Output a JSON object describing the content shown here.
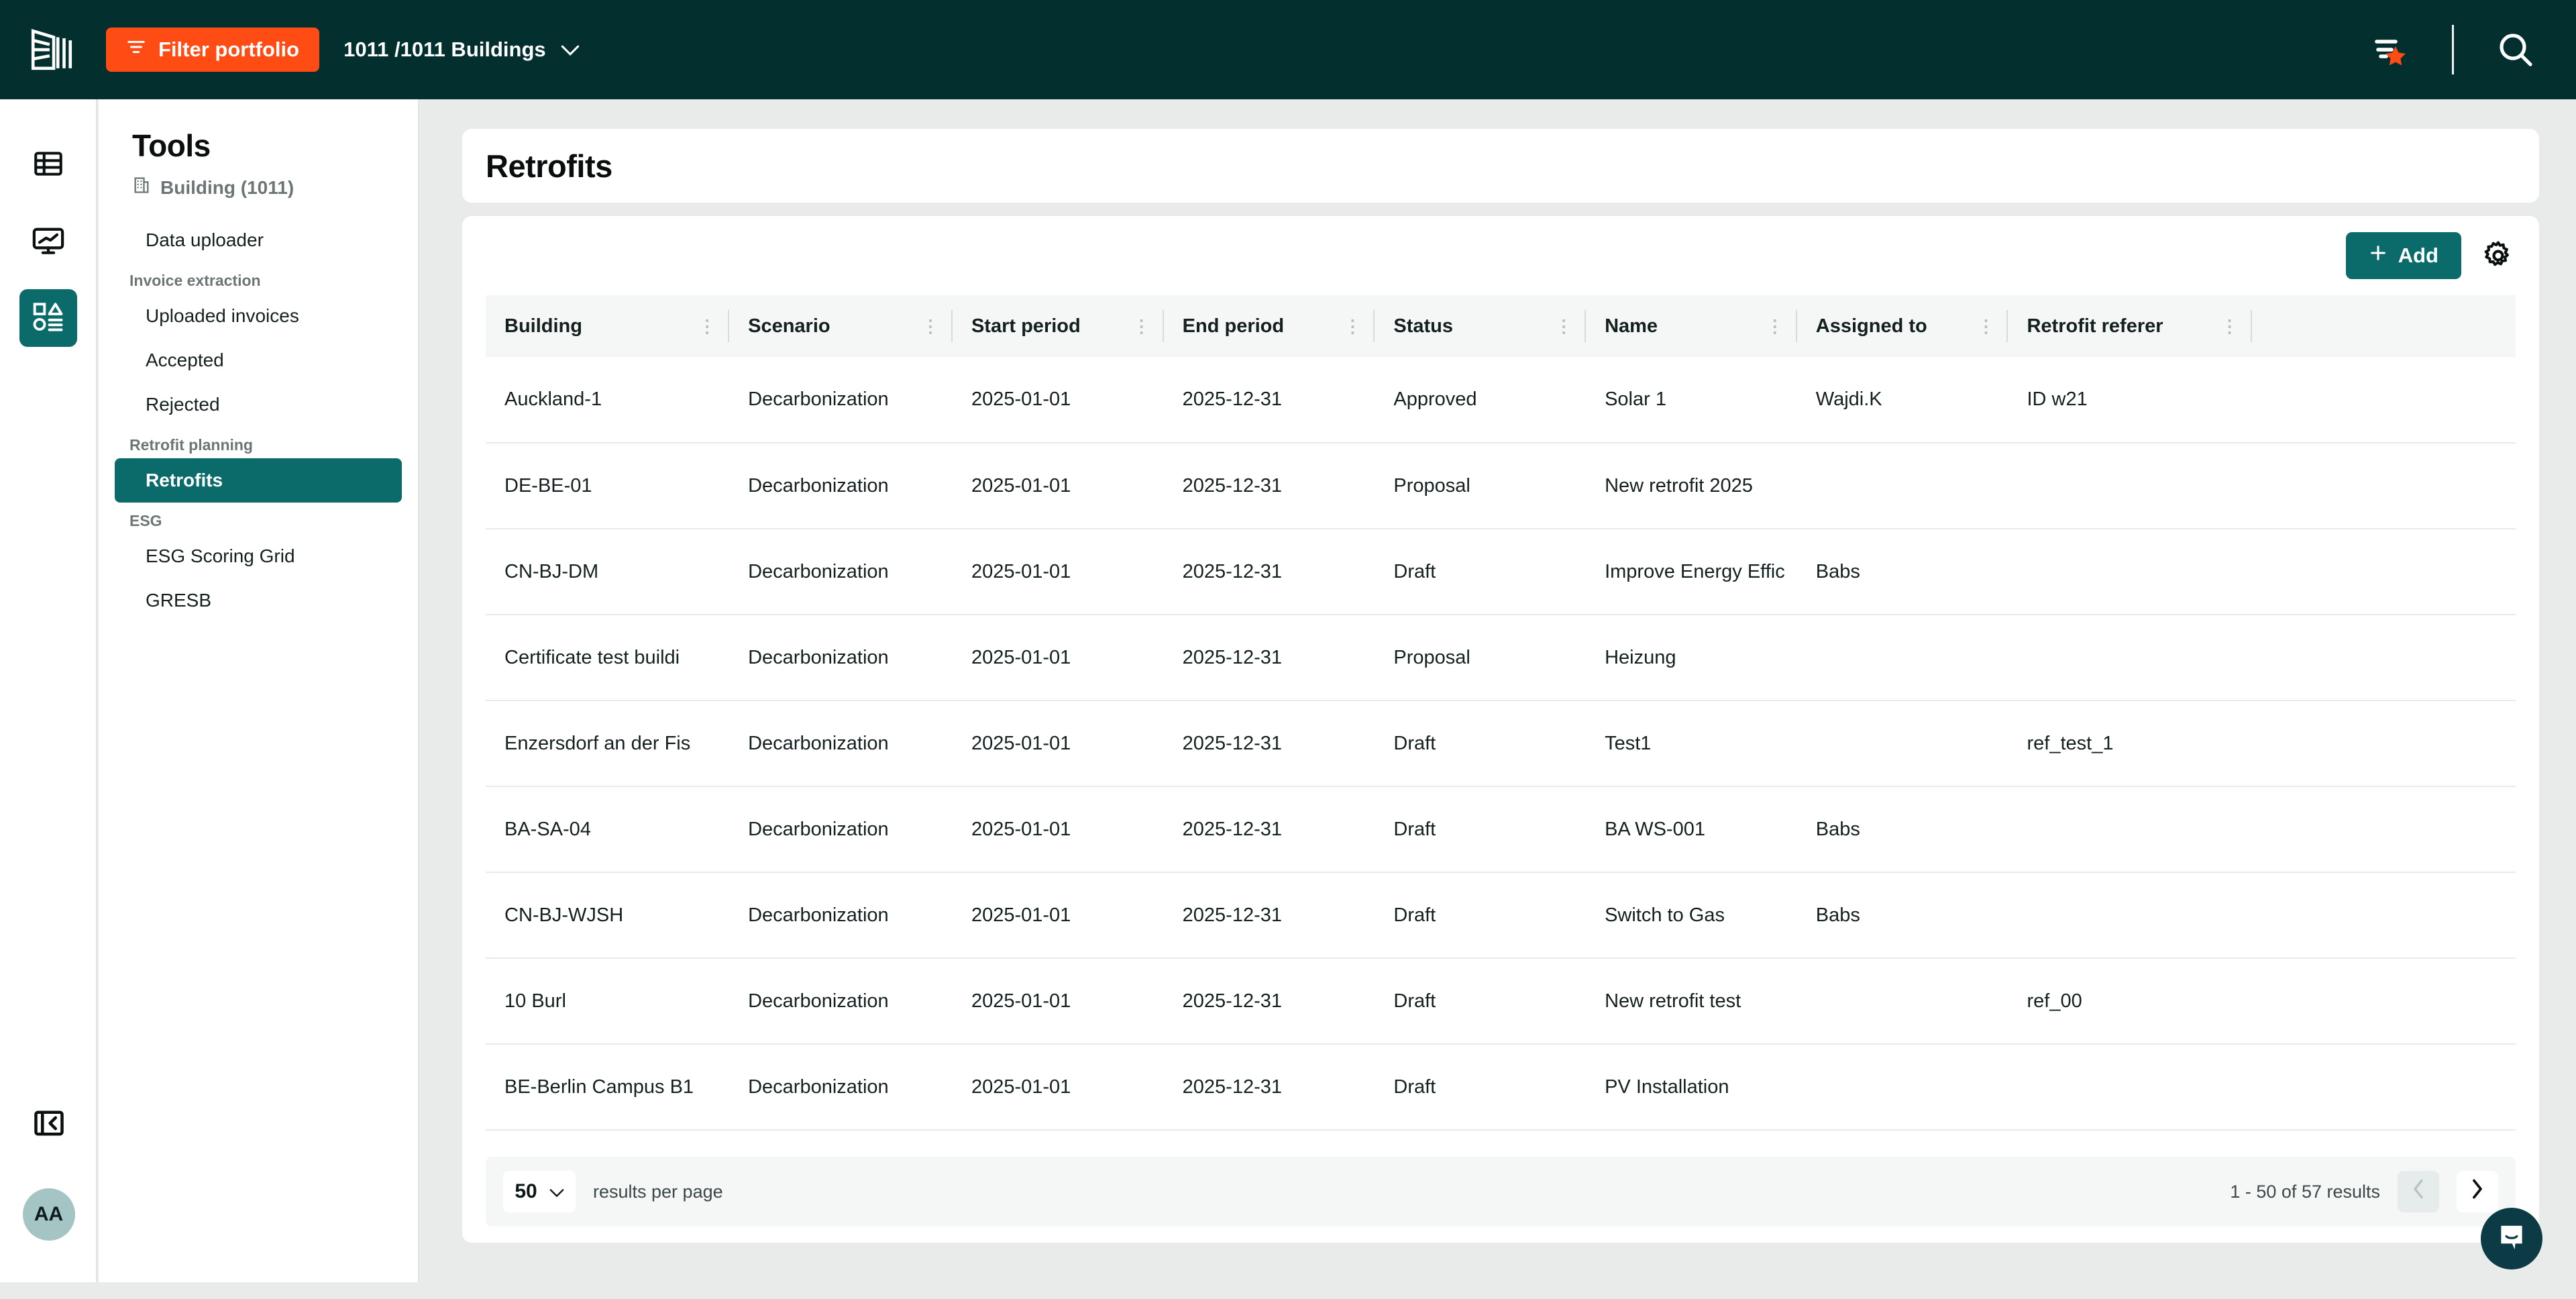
{
  "topbar": {
    "logo_icon": "building-logo-icon",
    "filter_button": {
      "label": "Filter portfolio",
      "icon": "filter-icon",
      "color": "#ff4b14"
    },
    "portfolio_selector": {
      "label": "1011 /1011 Buildings",
      "icon": "chevron-down-icon"
    },
    "favorite_filter_icon": "filter-star-icon",
    "search_icon": "search-icon",
    "background": "#03302f"
  },
  "rail": {
    "items": [
      {
        "icon": "table-grid-icon",
        "active": false
      },
      {
        "icon": "monitor-chart-icon",
        "active": false
      },
      {
        "icon": "shapes-list-icon",
        "active": true
      }
    ],
    "collapse_icon": "panel-collapse-left-icon",
    "avatar_initials": "AA",
    "active_color": "#0b6b6b"
  },
  "sidebar": {
    "title": "Tools",
    "subtitle": "Building (1011)",
    "subtitle_icon": "building-icon",
    "nav": [
      {
        "type": "item",
        "label": "Data uploader",
        "active": false
      },
      {
        "type": "group",
        "label": "Invoice extraction"
      },
      {
        "type": "item",
        "label": "Uploaded invoices",
        "active": false
      },
      {
        "type": "item",
        "label": "Accepted",
        "active": false
      },
      {
        "type": "item",
        "label": "Rejected",
        "active": false
      },
      {
        "type": "group",
        "label": "Retrofit planning"
      },
      {
        "type": "item",
        "label": "Retrofits",
        "active": true
      },
      {
        "type": "group",
        "label": "ESG"
      },
      {
        "type": "item",
        "label": "ESG Scoring Grid",
        "active": false
      },
      {
        "type": "item",
        "label": "GRESB",
        "active": false
      }
    ]
  },
  "main": {
    "page_title": "Retrofits",
    "toolbar": {
      "add_label": "Add",
      "add_icon": "plus-icon",
      "settings_icon": "gear-icon"
    },
    "table": {
      "columns": [
        "Building",
        "Scenario",
        "Start period",
        "End period",
        "Status",
        "Name",
        "Assigned to",
        "Retrofit referer"
      ],
      "rows": [
        [
          "Auckland-1",
          "Decarbonization",
          "2025-01-01",
          "2025-12-31",
          "Approved",
          "Solar 1",
          "Wajdi.K",
          "ID w21"
        ],
        [
          "DE-BE-01",
          "Decarbonization",
          "2025-01-01",
          "2025-12-31",
          "Proposal",
          "New retrofit 2025",
          "",
          ""
        ],
        [
          "CN-BJ-DM",
          "Decarbonization",
          "2025-01-01",
          "2025-12-31",
          "Draft",
          "Improve Energy Effic",
          "Babs",
          ""
        ],
        [
          "Certificate test buildi",
          "Decarbonization",
          "2025-01-01",
          "2025-12-31",
          "Proposal",
          "Heizung",
          "",
          ""
        ],
        [
          "Enzersdorf an der Fis",
          "Decarbonization",
          "2025-01-01",
          "2025-12-31",
          "Draft",
          "Test1",
          "",
          "ref_test_1"
        ],
        [
          "BA-SA-04",
          "Decarbonization",
          "2025-01-01",
          "2025-12-31",
          "Draft",
          "BA WS-001",
          "Babs",
          ""
        ],
        [
          "CN-BJ-WJSH",
          "Decarbonization",
          "2025-01-01",
          "2025-12-31",
          "Draft",
          "Switch to Gas",
          "Babs",
          ""
        ],
        [
          "10 Burl",
          "Decarbonization",
          "2025-01-01",
          "2025-12-31",
          "Draft",
          "New retrofit test",
          "",
          "ref_00"
        ],
        [
          "BE-Berlin Campus B1",
          "Decarbonization",
          "2025-01-01",
          "2025-12-31",
          "Draft",
          "PV Installation",
          "",
          ""
        ]
      ]
    },
    "pagination": {
      "per_page_value": "50",
      "per_page_label": "results per page",
      "results_text": "1 -  50 of  57 results",
      "prev_icon": "chevron-left-icon",
      "next_icon": "chevron-right-icon"
    }
  },
  "chat": {
    "icon": "chat-bubble-icon",
    "color": "#0c3b45"
  }
}
